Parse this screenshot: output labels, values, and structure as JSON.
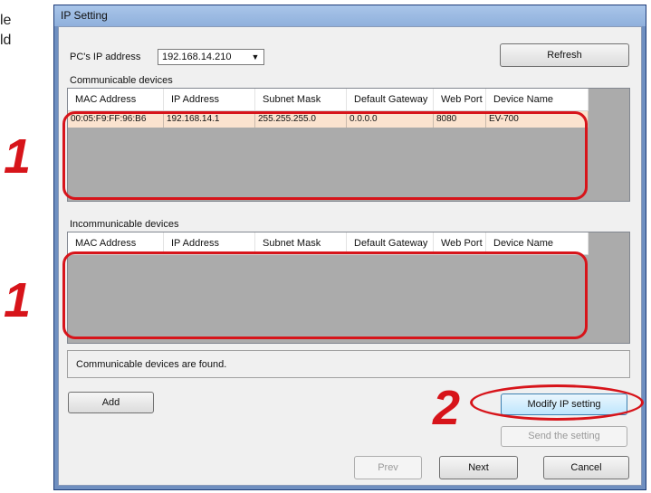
{
  "doc_fragment": {
    "line1": "le",
    "line2": "ld"
  },
  "steps": {
    "step1_top": "1",
    "step1_bottom": "1",
    "step2": "2"
  },
  "window": {
    "title": "IP Setting"
  },
  "pc_ip": {
    "label": "PC's IP address",
    "value": "192.168.14.210"
  },
  "buttons": {
    "refresh": "Refresh",
    "add": "Add",
    "modify": "Modify IP setting",
    "send": "Send the setting",
    "prev": "Prev",
    "next": "Next",
    "cancel": "Cancel"
  },
  "communicable": {
    "label": "Communicable devices",
    "columns": [
      "MAC Address",
      "IP Address",
      "Subnet Mask",
      "Default Gateway",
      "Web Port",
      "Device Name"
    ],
    "rows": [
      [
        "00:05:F9:FF:96:B6",
        "192.168.14.1",
        "255.255.255.0",
        "0.0.0.0",
        "8080",
        "EV-700"
      ]
    ]
  },
  "incommunicable": {
    "label": "Incommunicable devices",
    "columns": [
      "MAC Address",
      "IP Address",
      "Subnet Mask",
      "Default Gateway",
      "Web Port",
      "Device Name"
    ]
  },
  "status": {
    "text": "Communicable devices are found."
  },
  "colors": {
    "callout": "#d7141a",
    "selected_row": "#fbe3cf",
    "list_background": "#ababab"
  }
}
